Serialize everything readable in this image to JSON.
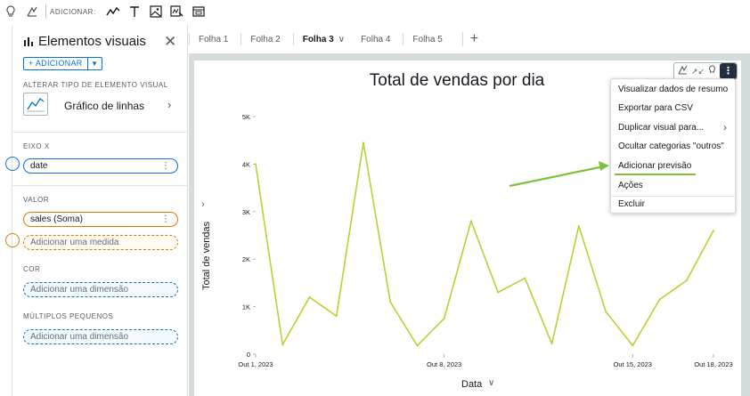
{
  "toolbar": {
    "add_label": "ADICIONAR:",
    "icons": [
      "lightbulb-icon",
      "insight-icon",
      "line-chart-icon",
      "text-icon",
      "image-icon",
      "custom-visual-icon",
      "filter-control-icon"
    ]
  },
  "panel": {
    "title": "Elementos visuais",
    "add_button": "+ ADICIONAR",
    "change_type_label": "ALTERAR TIPO DE ELEMENTO VISUAL",
    "visual_type": "Gráfico de linhas",
    "x_axis_label": "EIXO X",
    "x_axis_field": "date",
    "value_label": "VALOR",
    "value_field": "sales (Soma)",
    "add_measure": "Adicionar uma medida",
    "color_label": "COR",
    "add_dimension_color": "Adicionar uma dimensão",
    "small_multiples_label": "MÚLTIPLOS PEQUENOS",
    "add_dimension_multiples": "Adicionar uma dimensão"
  },
  "tabs": [
    {
      "label": "Folha 1"
    },
    {
      "label": "Folha 2"
    },
    {
      "label": "Folha 3"
    },
    {
      "label": "Folha 4"
    },
    {
      "label": "Folha 5"
    }
  ],
  "menu": {
    "items": [
      "Visualizar dados de resumo",
      "Exportar para CSV",
      "Duplicar visual para...",
      "Ocultar categorias \"outros\"",
      "Adicionar previsão",
      "Ações",
      "Excluir"
    ]
  },
  "colors": {
    "line": "#b5d334",
    "accent": "#0972d3",
    "measure": "#e07b00",
    "annotation": "#7ec13c"
  },
  "chart_data": {
    "type": "line",
    "title": "Total de vendas por dia",
    "xlabel": "Data",
    "ylabel": "Total de vendas",
    "x_tick_labels": [
      "Out 1, 2023",
      "Out 8, 2023",
      "Out 15, 2023",
      "Out 18, 2023"
    ],
    "y_tick_labels": [
      "0",
      "1K",
      "2K",
      "3K",
      "4K",
      "5K"
    ],
    "ylim": [
      0,
      5000
    ],
    "grid": false,
    "x": [
      "2023-10-01",
      "2023-10-02",
      "2023-10-03",
      "2023-10-04",
      "2023-10-05",
      "2023-10-06",
      "2023-10-07",
      "2023-10-08",
      "2023-10-09",
      "2023-10-10",
      "2023-10-11",
      "2023-10-12",
      "2023-10-13",
      "2023-10-14",
      "2023-10-15",
      "2023-10-16",
      "2023-10-17",
      "2023-10-18"
    ],
    "values": [
      4000,
      200,
      1200,
      800,
      4450,
      1100,
      180,
      750,
      2800,
      1300,
      1600,
      220,
      2700,
      900,
      180,
      1150,
      1550,
      2600
    ]
  }
}
